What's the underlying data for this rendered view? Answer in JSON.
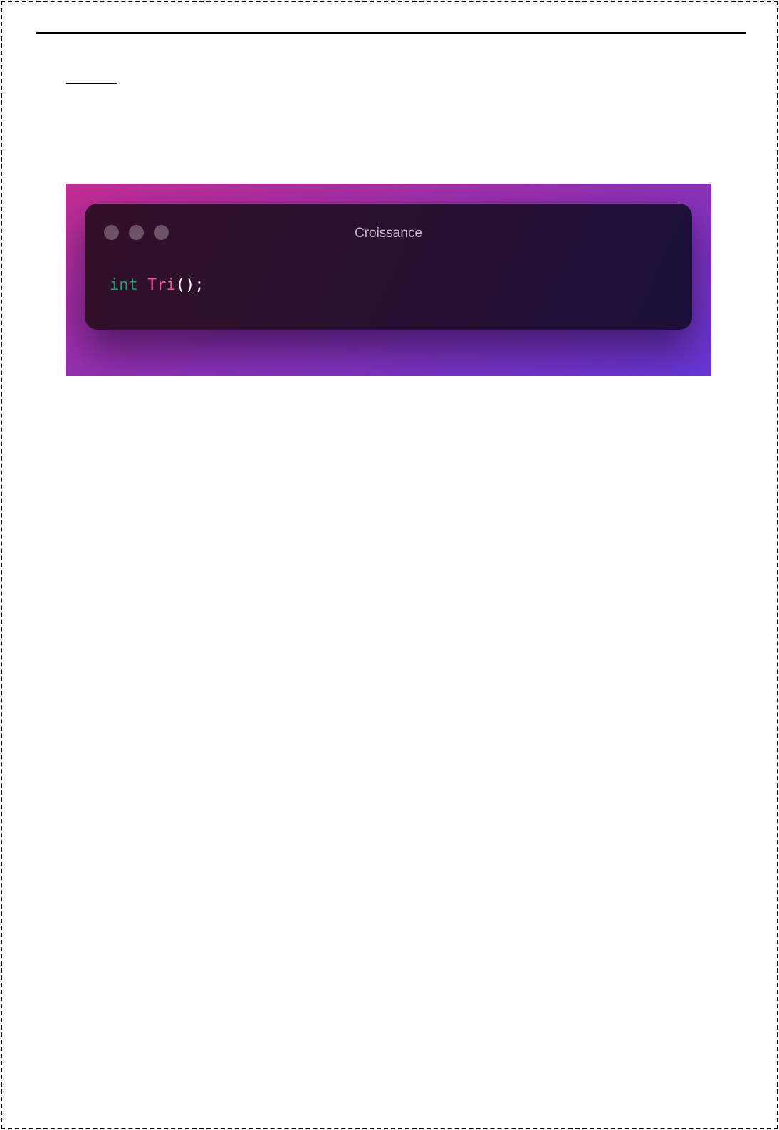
{
  "code_snippet": {
    "window_title": "Croissance",
    "window_dots": [
      "window-dot-1",
      "window-dot-2",
      "window-dot-3"
    ],
    "code_tokens": [
      {
        "text": "int",
        "color": "#1f9e72"
      },
      {
        "text": " ",
        "color": "#ffffff"
      },
      {
        "text": "Tri",
        "color": "#ff4fa0"
      },
      {
        "text": "();",
        "color": "#ffffff"
      }
    ],
    "colors": {
      "background_gradient_start": "#c42d93",
      "background_gradient_mid": "#8f31b3",
      "background_gradient_end": "#6637d6",
      "window_bg_start": "#331027",
      "window_bg_end": "#1b1039",
      "window_title": "#c7b8c8",
      "window_dot": "#6c5264"
    }
  }
}
